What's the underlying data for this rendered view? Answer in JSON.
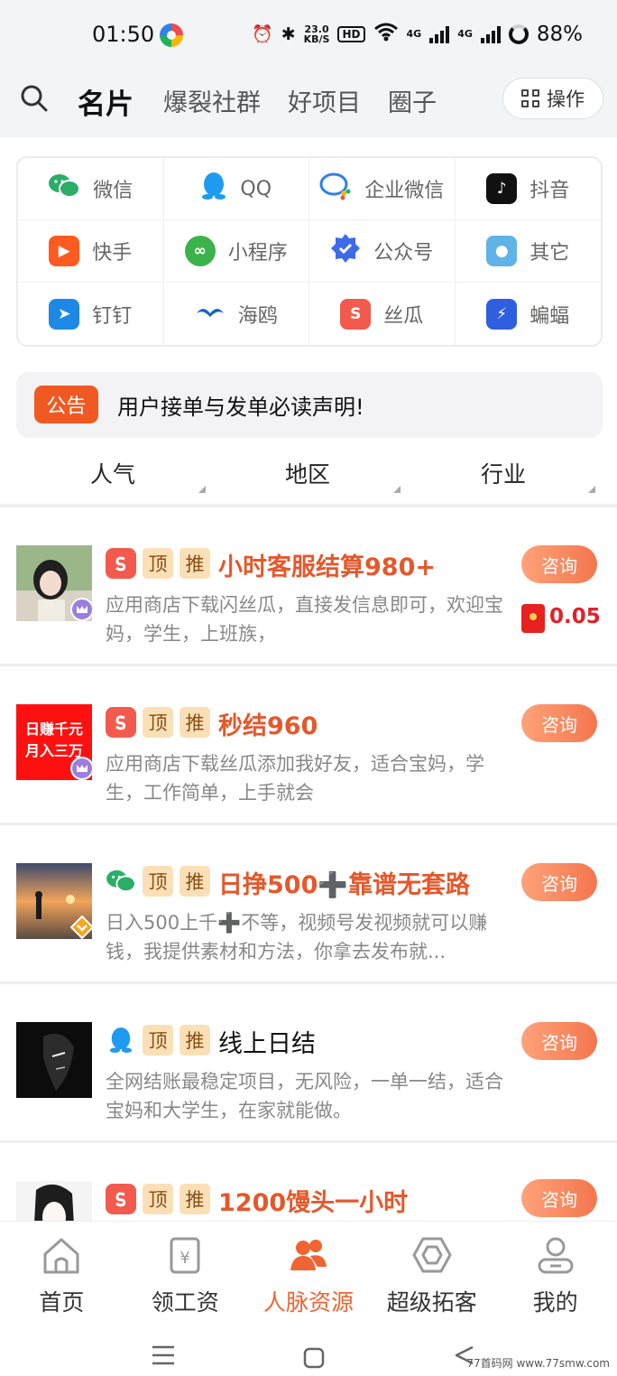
{
  "status_bar": {
    "time": "01:50",
    "net_speed_value": "23.0",
    "net_speed_unit": "KB/S",
    "hd_label": "HD",
    "net_label_1": "4G",
    "net_label_2": "4G",
    "battery": "88%"
  },
  "top_nav": {
    "tabs": [
      "名片",
      "爆裂社群",
      "好项目",
      "圈子"
    ],
    "active_tab": 0,
    "operate_label": "操作"
  },
  "platforms": [
    {
      "label": "微信",
      "icon": "wechat-icon",
      "color": "#2aae67"
    },
    {
      "label": "QQ",
      "icon": "qq-icon",
      "color": "#1e9bf0"
    },
    {
      "label": "企业微信",
      "icon": "wecom-icon",
      "color": "#2f80ed"
    },
    {
      "label": "抖音",
      "icon": "douyin-icon",
      "color": "#111111"
    },
    {
      "label": "快手",
      "icon": "kuaishou-icon",
      "color": "#ff5a1f"
    },
    {
      "label": "小程序",
      "icon": "mini-program-icon",
      "color": "#3bb34a"
    },
    {
      "label": "公众号",
      "icon": "official-account-icon",
      "color": "#3d6be8"
    },
    {
      "label": "其它",
      "icon": "other-icon",
      "color": "#5fb3e8"
    },
    {
      "label": "钉钉",
      "icon": "dingtalk-icon",
      "color": "#1e88e5"
    },
    {
      "label": "海鸥",
      "icon": "seagull-icon",
      "color": "#1565c0"
    },
    {
      "label": "丝瓜",
      "icon": "sigua-icon",
      "color": "#f25a4e"
    },
    {
      "label": "蝙蝠",
      "icon": "bat-icon",
      "color": "#2f5fe0"
    }
  ],
  "notice": {
    "badge": "公告",
    "text": "用户接单与发单必读声明!"
  },
  "filters": [
    "人气",
    "地区",
    "行业"
  ],
  "colors": {
    "accent": "#ef6433",
    "title_red": "#e5582b",
    "tag_bg": "#fbe0b7",
    "reward_red": "#e3202a"
  },
  "listings": [
    {
      "title": "小时客服结算980+",
      "desc": "应用商店下载闪丝瓜，直接发信息即可，欢迎宝妈，学生，上班族，",
      "source": "sigua-icon",
      "tags": [
        "顶",
        "推"
      ],
      "consult": "咨询",
      "reward": "0.05",
      "avatar": "girl-photo-avatar",
      "badge": "vip"
    },
    {
      "title": "秒结960",
      "desc": "应用商店下载丝瓜添加我好友，适合宝妈，学生，工作简单，上手就会",
      "source": "sigua-icon",
      "tags": [
        "顶",
        "推"
      ],
      "consult": "咨询",
      "avatar_text": [
        "日赚千元",
        "月入三万"
      ],
      "badge": "vip"
    },
    {
      "title": "日挣500➕靠谱无套路",
      "desc": "日入500上千➕不等，视频号发视频就可以赚钱，我提供素材和方法，你拿去发布就...",
      "source": "wechat-icon",
      "tags": [
        "顶",
        "推"
      ],
      "consult": "咨询",
      "avatar": "sunset-photo-avatar",
      "badge": "gold"
    },
    {
      "title": "线上日结",
      "desc": "全网结账最稳定项目，无风险，一单一结，适合宝妈和大学生，在家就能做。",
      "source": "qq-icon",
      "tags": [
        "顶",
        "推"
      ],
      "consult": "咨询",
      "avatar": "dark-sketch-avatar"
    },
    {
      "title": "1200馒头一小时",
      "desc": "",
      "source": "sigua-icon",
      "tags": [
        "顶",
        "推"
      ],
      "consult": "咨询",
      "avatar": "girl-sketch-avatar"
    }
  ],
  "bottom_tabs": [
    {
      "label": "首页",
      "icon": "home-icon"
    },
    {
      "label": "领工资",
      "icon": "salary-icon"
    },
    {
      "label": "人脉资源",
      "icon": "contacts-icon",
      "active": true
    },
    {
      "label": "超级拓客",
      "icon": "hexagon-icon"
    },
    {
      "label": "我的",
      "icon": "profile-icon"
    }
  ],
  "watermark": "77首码网 www.77smw.com"
}
